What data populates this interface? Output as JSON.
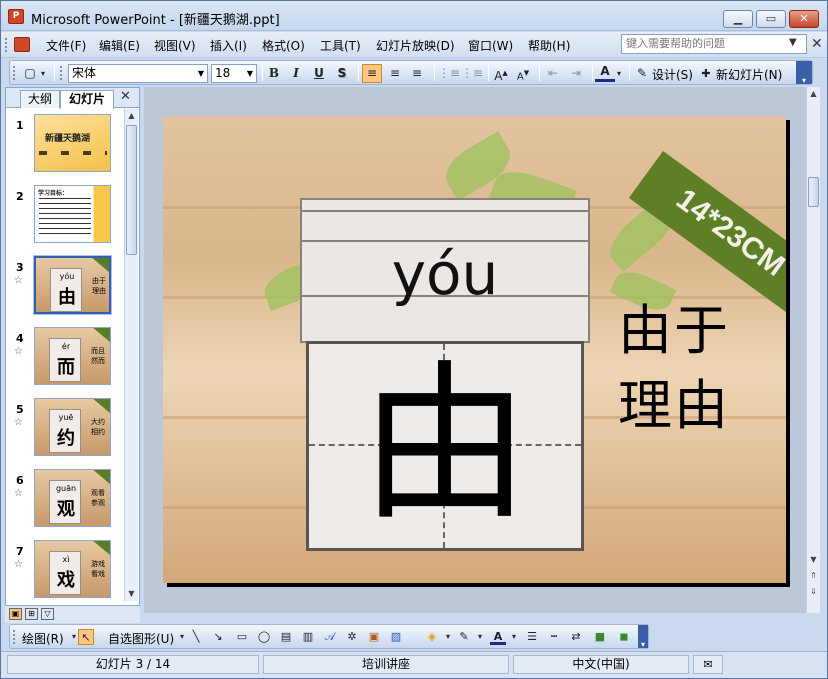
{
  "window": {
    "title": "Microsoft PowerPoint - [新疆天鹅湖.ppt]",
    "app_icon": "P",
    "controls": [
      "minimize",
      "maximize",
      "close"
    ]
  },
  "menubar": {
    "items": [
      {
        "label": "文件(F)"
      },
      {
        "label": "编辑(E)"
      },
      {
        "label": "视图(V)"
      },
      {
        "label": "插入(I)"
      },
      {
        "label": "格式(O)"
      },
      {
        "label": "工具(T)"
      },
      {
        "label": "幻灯片放映(D)"
      },
      {
        "label": "窗口(W)"
      },
      {
        "label": "帮助(H)"
      }
    ],
    "help_placeholder": "键入需要帮助的问题"
  },
  "toolbar": {
    "font_name": "宋体",
    "font_size": "18",
    "bold": "B",
    "italic": "I",
    "underline": "U",
    "shadow": "S",
    "design_label": "设计(S)",
    "new_slide_label": "新幻灯片(N)"
  },
  "panel": {
    "tabs": [
      "大纲",
      "幻灯片"
    ],
    "selected_tab": "幻灯片",
    "thumbnails": [
      {
        "num": "1",
        "char": "",
        "pinyin": "",
        "words": "",
        "title": "新疆天鹅湖"
      },
      {
        "num": "2",
        "char": "",
        "pinyin": "",
        "words": "",
        "title": "学习目标："
      },
      {
        "num": "3",
        "char": "由",
        "pinyin": "yóu",
        "words": "由于 理由",
        "title": ""
      },
      {
        "num": "4",
        "char": "而",
        "pinyin": "ér",
        "words": "而且 然而",
        "title": ""
      },
      {
        "num": "5",
        "char": "约",
        "pinyin": "yuē",
        "words": "大约 相约",
        "title": ""
      },
      {
        "num": "6",
        "char": "观",
        "pinyin": "guān",
        "words": "观看 参观",
        "title": ""
      },
      {
        "num": "7",
        "char": "戏",
        "pinyin": "xì",
        "words": "游戏 看戏",
        "title": ""
      }
    ],
    "selected_index": 3
  },
  "slide": {
    "pinyin": "yóu",
    "character": "由",
    "word1": "由于",
    "word2": "理由",
    "corner_label": "14*23CM"
  },
  "drawbar": {
    "draw_label": "绘图(R)",
    "autoshape_label": "自选图形(U)"
  },
  "status": {
    "slide_info": "幻灯片 3 / 14",
    "design_name": "培训讲座",
    "language": "中文(中国)"
  },
  "colors": {
    "accent": "#d24726",
    "selection": "#2f61b0",
    "toolbar_bg": "#c8d7ee",
    "corner_band": "#5f7f27"
  }
}
